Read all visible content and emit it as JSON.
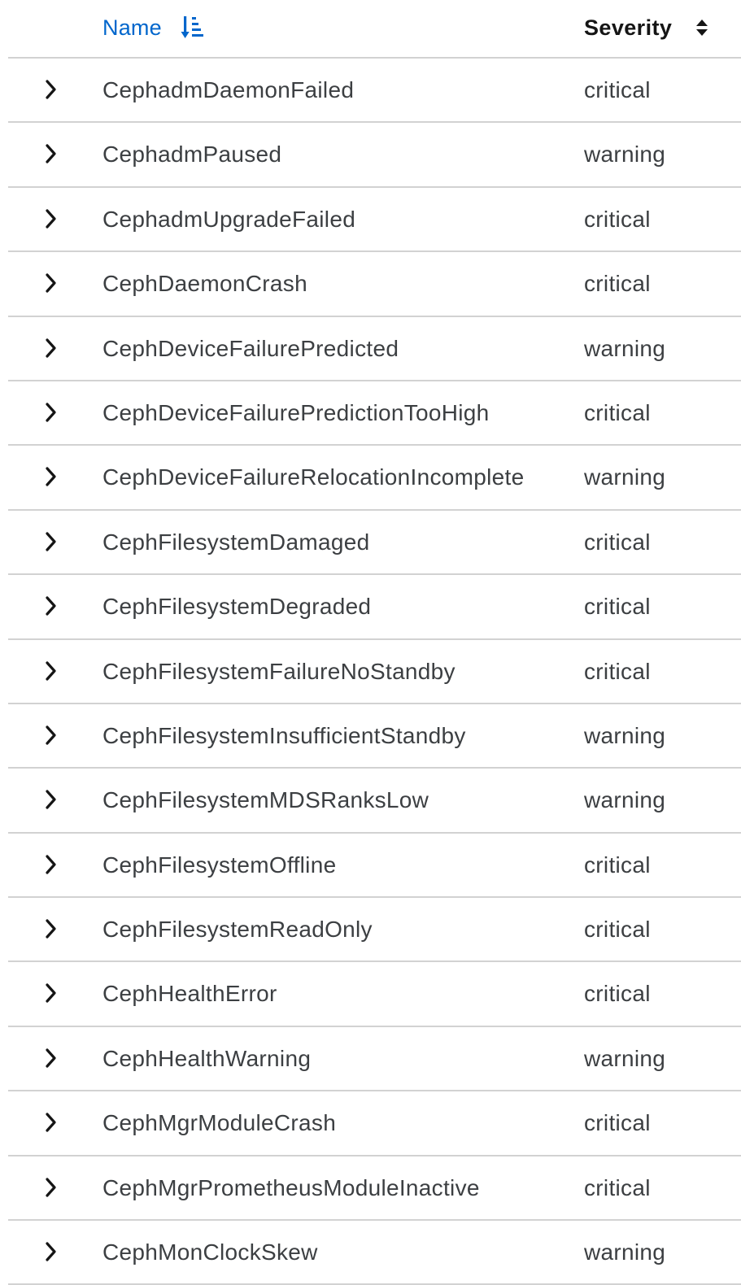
{
  "table": {
    "columns": {
      "name": {
        "label": "Name",
        "sort_icon": "sort-amount-down-icon"
      },
      "severity": {
        "label": "Severity",
        "sort_icon": "sort-unsorted-icon"
      }
    },
    "expand_icon": "chevron-right-icon",
    "rows": [
      {
        "name": "CephadmDaemonFailed",
        "severity": "critical"
      },
      {
        "name": "CephadmPaused",
        "severity": "warning"
      },
      {
        "name": "CephadmUpgradeFailed",
        "severity": "critical"
      },
      {
        "name": "CephDaemonCrash",
        "severity": "critical"
      },
      {
        "name": "CephDeviceFailurePredicted",
        "severity": "warning"
      },
      {
        "name": "CephDeviceFailurePredictionTooHigh",
        "severity": "critical"
      },
      {
        "name": "CephDeviceFailureRelocationIncomplete",
        "severity": "warning"
      },
      {
        "name": "CephFilesystemDamaged",
        "severity": "critical"
      },
      {
        "name": "CephFilesystemDegraded",
        "severity": "critical"
      },
      {
        "name": "CephFilesystemFailureNoStandby",
        "severity": "critical"
      },
      {
        "name": "CephFilesystemInsufficientStandby",
        "severity": "warning"
      },
      {
        "name": "CephFilesystemMDSRanksLow",
        "severity": "warning"
      },
      {
        "name": "CephFilesystemOffline",
        "severity": "critical"
      },
      {
        "name": "CephFilesystemReadOnly",
        "severity": "critical"
      },
      {
        "name": "CephHealthError",
        "severity": "critical"
      },
      {
        "name": "CephHealthWarning",
        "severity": "warning"
      },
      {
        "name": "CephMgrModuleCrash",
        "severity": "critical"
      },
      {
        "name": "CephMgrPrometheusModuleInactive",
        "severity": "critical"
      },
      {
        "name": "CephMonClockSkew",
        "severity": "warning"
      }
    ]
  },
  "colors": {
    "link": "#0066cc",
    "text": "#3c3f42",
    "header_text": "#151515",
    "divider": "#d2d2d2"
  }
}
